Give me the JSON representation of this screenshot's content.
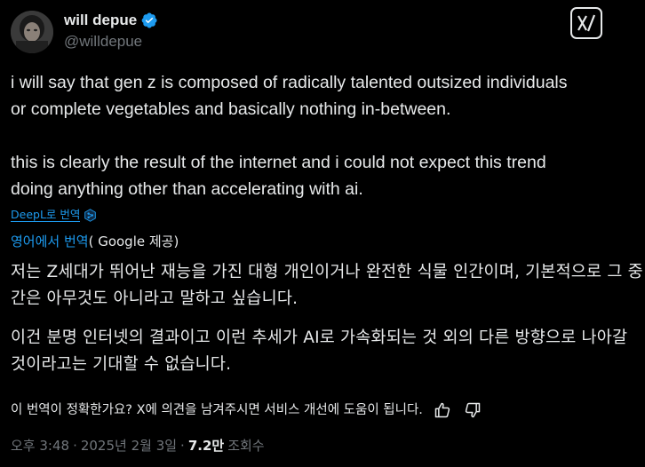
{
  "author": {
    "display_name": "will depue",
    "handle": "@willdepue"
  },
  "tweet": {
    "para1": "i will say that gen z is composed of radically talented outsized individuals\nor complete vegetables and basically nothing in-between.",
    "para2": "this is clearly the result of the internet and i could not expect this trend\ndoing anything other than accelerating with ai."
  },
  "deepl": {
    "label": "DeepL로 번역"
  },
  "google": {
    "link": "영어에서 번역",
    "rest": "( Google 제공)"
  },
  "translation": {
    "para1": "저는 Z세대가 뛰어난 재능을 가진 대형 개인이거나 완전한 식물 인간이며, 기본적으로 그 중간은 아무것도 아니라고 말하고 싶습니다.",
    "para2": "이건 분명 인터넷의 결과이고 이런 추세가 AI로 가속화되는 것 외의 다른 방향으로 나아갈 것이라고는 기대할 수 없습니다."
  },
  "feedback": {
    "text": "이 번역이 정확한가요? X에 의견을 남겨주시면 서비스 개선에 도움이 됩니다."
  },
  "meta": {
    "time": "오후 3:48",
    "separator": "·",
    "date": "2025년 2월 3일",
    "views_count": "7.2만",
    "views_label": "조회수"
  },
  "icons": {
    "verified": "verified-badge-icon",
    "grok": "grok-logo-icon",
    "deepl": "deepl-icon",
    "thumbs_up": "thumbs-up-icon",
    "thumbs_down": "thumbs-down-icon"
  },
  "colors": {
    "background": "#000000",
    "text": "#e7e9ea",
    "muted": "#71767b",
    "accent": "#1d9bf0"
  }
}
